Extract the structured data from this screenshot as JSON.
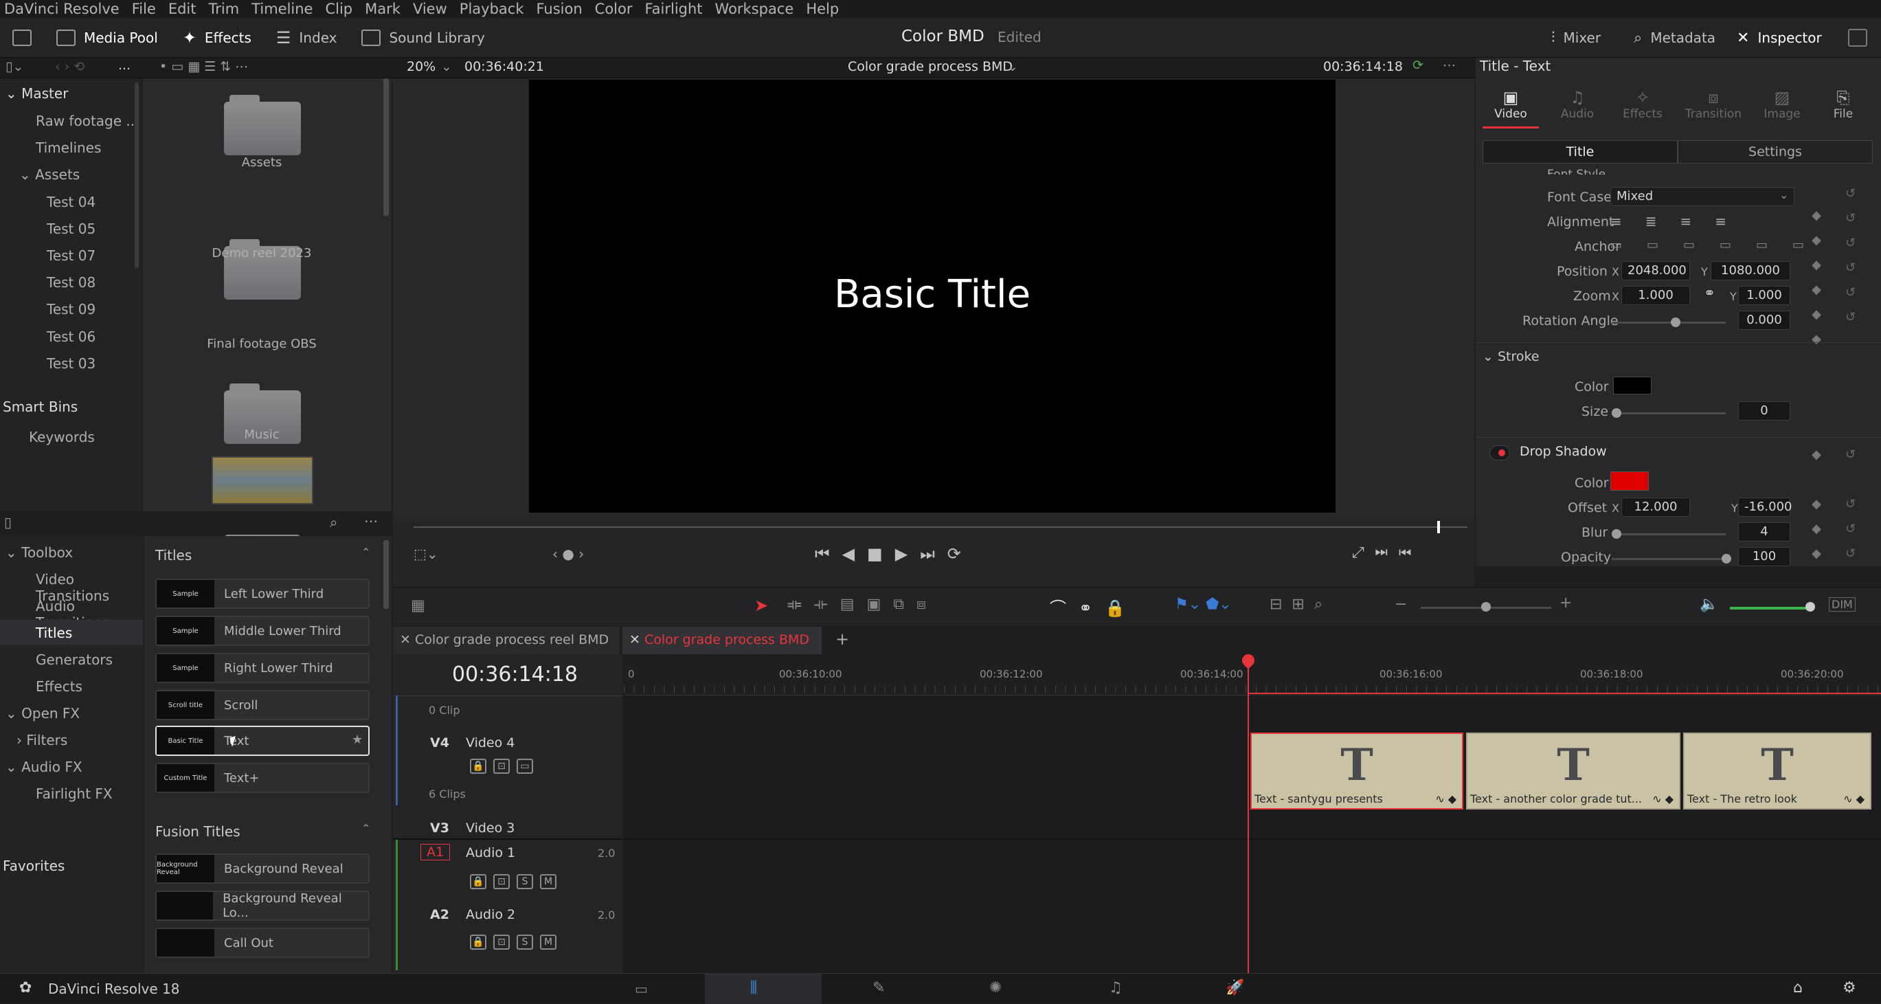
{
  "menu": [
    "DaVinci Resolve",
    "File",
    "Edit",
    "Trim",
    "Timeline",
    "Clip",
    "Mark",
    "View",
    "Playback",
    "Fusion",
    "Color",
    "Fairlight",
    "Workspace",
    "Help"
  ],
  "toolbar": {
    "media_pool": "Media Pool",
    "effects": "Effects",
    "index": "Index",
    "sound_library": "Sound Library",
    "project_title": "Color BMD",
    "status": "Edited",
    "mixer": "Mixer",
    "metadata": "Metadata",
    "inspector": "Inspector"
  },
  "viewer": {
    "zoom": "20%",
    "timecode_left": "00:36:40:21",
    "timeline_name": "Color grade process BMD",
    "timecode_right": "00:36:14:18",
    "overlay_text": "Basic Title"
  },
  "bins": {
    "more": "...",
    "master": "Master",
    "items": [
      "Raw footage ...",
      "Timelines",
      "Assets",
      "Test 04",
      "Test 05",
      "Test 07",
      "Test 08",
      "Test 09",
      "Test 06",
      "Test 03"
    ],
    "smart_bins": "Smart Bins",
    "keywords": "Keywords"
  },
  "folders": [
    "Assets",
    "Demo reel 2023",
    "Final footage OBS",
    "Music"
  ],
  "toolbox": {
    "items": [
      "Toolbox",
      "Video Transitions",
      "Audio Transitions",
      "Titles",
      "Generators",
      "Effects",
      "Open FX",
      "Filters",
      "Audio FX",
      "Fairlight FX"
    ],
    "favorites": "Favorites"
  },
  "titles": {
    "header": "Titles",
    "items": [
      {
        "thumb": "Sample",
        "label": "Left Lower Third"
      },
      {
        "thumb": "Sample",
        "label": "Middle Lower Third"
      },
      {
        "thumb": "Sample",
        "label": "Right Lower Third"
      },
      {
        "thumb": "Scroll title",
        "label": "Scroll"
      },
      {
        "thumb": "Basic Title",
        "label": "Text"
      },
      {
        "thumb": "Custom Title",
        "label": "Text+"
      }
    ],
    "fusion_header": "Fusion Titles",
    "fusion_items": [
      {
        "thumb": "Background Reveal",
        "label": "Background Reveal"
      },
      {
        "thumb": "",
        "label": "Background Reveal Lo..."
      },
      {
        "thumb": "",
        "label": "Call Out"
      }
    ]
  },
  "inspector": {
    "header": "Title - Text",
    "tabs": [
      "Video",
      "Audio",
      "Effects",
      "Transition",
      "Image",
      "File"
    ],
    "subtabs": [
      "Title",
      "Settings"
    ],
    "font_style": "Font Style",
    "font_case_label": "Font Case",
    "font_case": "Mixed",
    "alignment": "Alignment",
    "anchor": "Anchor",
    "position_label": "Position",
    "pos_x": "2048.000",
    "pos_y": "1080.000",
    "zoom_label": "Zoom",
    "zoom_x": "1.000",
    "zoom_y": "1.000",
    "rotation_label": "Rotation Angle",
    "rotation": "0.000",
    "stroke_header": "Stroke",
    "stroke_color_label": "Color",
    "stroke_size_label": "Size",
    "stroke_size": "0",
    "shadow_header": "Drop Shadow",
    "shadow_color_label": "Color",
    "offset_label": "Offset",
    "offset_x": "12.000",
    "offset_y": "-16.000",
    "blur_label": "Blur",
    "blur": "4",
    "opacity_label": "Opacity",
    "opacity": "100",
    "x": "X",
    "y": "Y"
  },
  "timeline": {
    "tabs": [
      "Color grade process reel BMD",
      "Color grade process BMD"
    ],
    "timecode": "00:36:14:18",
    "ruler": [
      "0",
      "00:36:10:00",
      "00:36:12:00",
      "00:36:14:00",
      "00:36:16:00",
      "00:36:18:00",
      "00:36:20:00"
    ],
    "zero_clip": "0 Clip",
    "six_clips": "6 Clips",
    "tracks": [
      {
        "id": "V4",
        "name": "Video 4"
      },
      {
        "id": "V3",
        "name": "Video 3"
      },
      {
        "id": "A1",
        "name": "Audio 1",
        "ch": "2.0"
      },
      {
        "id": "A2",
        "name": "Audio 2",
        "ch": "2.0"
      }
    ],
    "clips": [
      "Text - santygu presents",
      "Text - another color grade tut...",
      "Text - The retro look"
    ],
    "solo": "S",
    "mute": "M"
  },
  "footer": {
    "app": "DaVinci Resolve 18"
  },
  "colors": {
    "accent_red": "#e8343b",
    "shadow_color": "#e00000",
    "stroke_color": "#000000",
    "clip": "#c9c2a4"
  }
}
